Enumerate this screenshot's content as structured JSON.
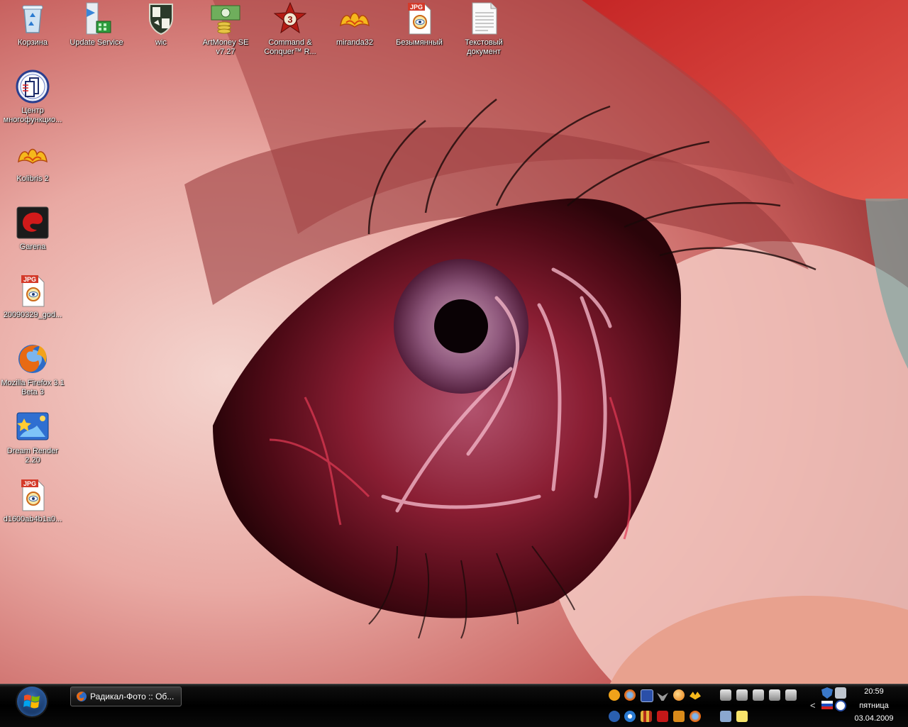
{
  "desktop": {
    "icons": [
      {
        "name": "recycle-bin",
        "label": "Корзина"
      },
      {
        "name": "update-service",
        "label": "Update Service"
      },
      {
        "name": "wic",
        "label": "wic"
      },
      {
        "name": "artmoney",
        "label": "ArtMoney SE v7.27"
      },
      {
        "name": "command-conquer",
        "label": "Command & Conquer™ R..."
      },
      {
        "name": "miranda32",
        "label": "miranda32"
      },
      {
        "name": "bezymyanny",
        "label": "Безымянный"
      },
      {
        "name": "text-document",
        "label": "Текстовый документ"
      },
      {
        "name": "multifunction-center",
        "label": "Центр многофункцио..."
      },
      {
        "name": "kolibris",
        "label": "Kolibris 2"
      },
      {
        "name": "garena",
        "label": "Garena"
      },
      {
        "name": "jpg-20090329",
        "label": "20090329_god..."
      },
      {
        "name": "firefox",
        "label": "Mozilla Firefox 3.1 Beta 3"
      },
      {
        "name": "dream-render",
        "label": "Dream Render 2.20"
      },
      {
        "name": "jpg-d1600ab4",
        "label": "d1600ab4b1a0..."
      }
    ],
    "jpg_badge": "JPG"
  },
  "taskbar": {
    "task_label": "Радикал-Фото :: Об...",
    "tray_arrow": "<",
    "clock": {
      "time": "20:59",
      "day": "пятница",
      "date": "03.04.2009"
    }
  },
  "colors": {
    "taskbar": "#000000",
    "label_text": "#ffffff",
    "wallpaper_accent": "#b3121c"
  }
}
